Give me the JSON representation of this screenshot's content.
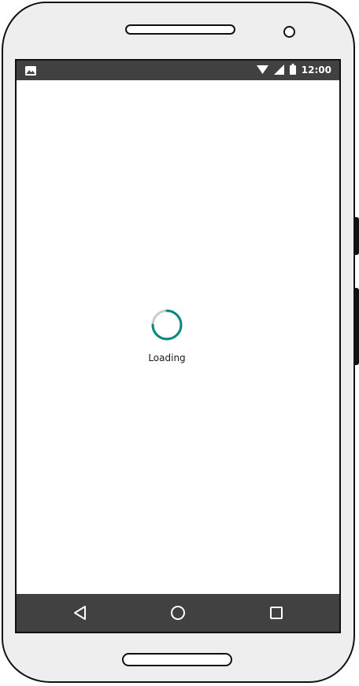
{
  "status_bar": {
    "time": "12:00",
    "icons": [
      "image-icon",
      "wifi-icon",
      "signal-icon",
      "battery-icon"
    ]
  },
  "loading": {
    "label": "Loading",
    "accent_color": "#00897b",
    "track_color": "#cccccc"
  },
  "nav_bar": {
    "buttons": [
      "back-icon",
      "home-icon",
      "recents-icon"
    ]
  },
  "colors": {
    "bar_background": "#414141",
    "device_body": "#eeeeee"
  }
}
